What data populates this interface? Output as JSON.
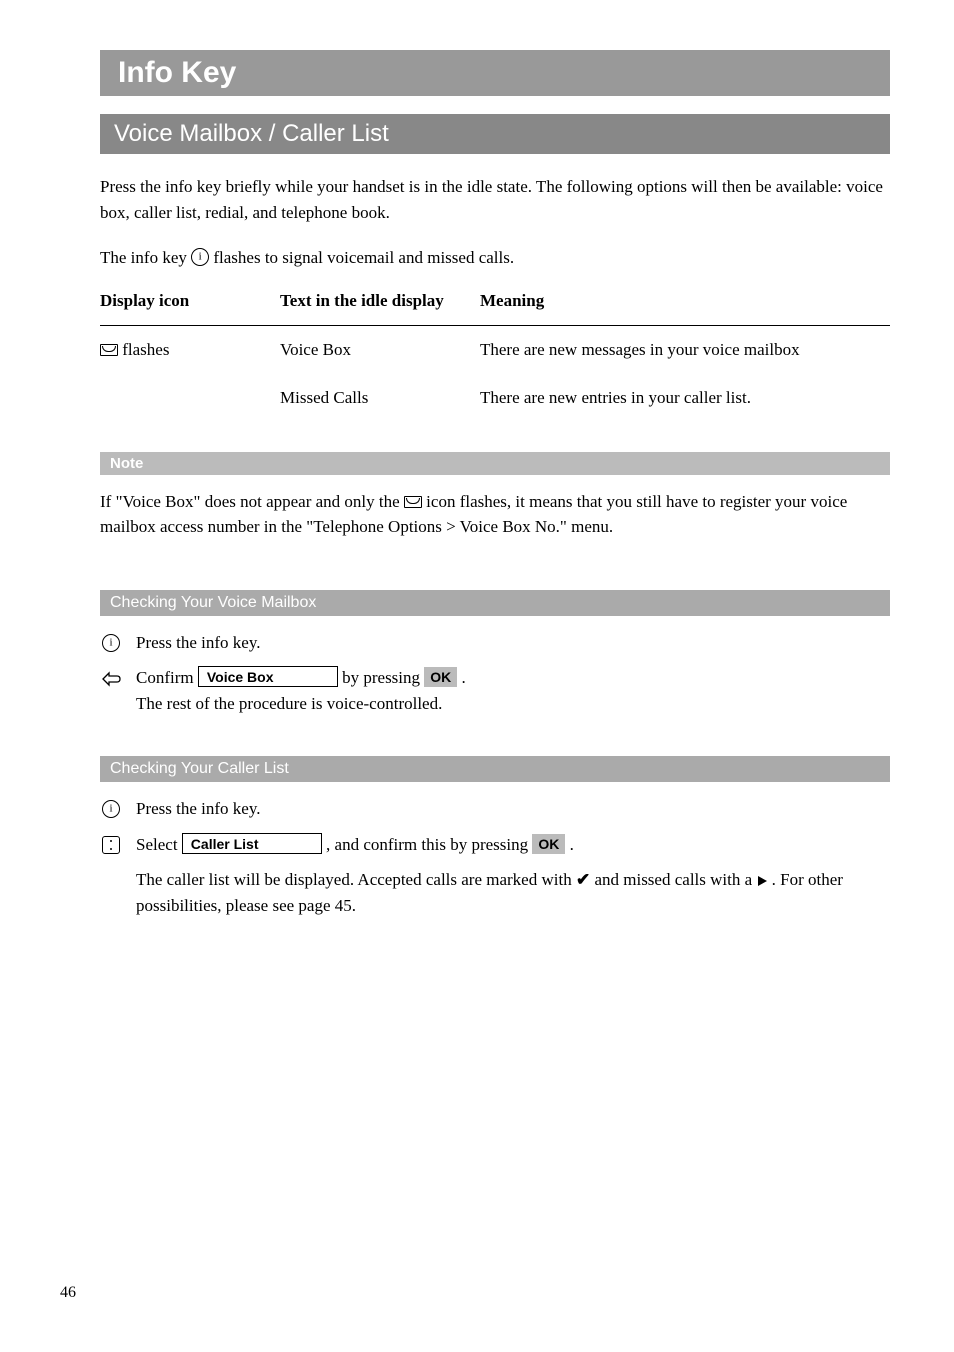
{
  "page_number": "46",
  "h1": "Info Key",
  "h2": "Voice Mailbox / Caller List",
  "intro_para": "Press the info key briefly while your handset is in the idle state. The following options will then be available: voice box, caller list, redial, and telephone book.",
  "info_line_pre": "The info key ",
  "info_line_post": " flashes to signal voicemail and missed calls.",
  "table": {
    "headers": {
      "c1": "Display icon",
      "c2": "Text in the idle display",
      "c3": "Meaning"
    },
    "rows": [
      {
        "c1_post": " flashes",
        "c2": "Voice Box",
        "c3": "There are new messages in your voice mailbox"
      },
      {
        "c1_post": "",
        "c2": "Missed Calls",
        "c3": "There are new entries in your caller list."
      }
    ]
  },
  "note_label": "Note",
  "note_pre": "If \"Voice Box\" does not appear and only the ",
  "note_post": " icon flashes, it means that you still have to register your voice mailbox access number in the \"Telephone Options > Voice Box No.\" menu.",
  "sec1": {
    "title": "Checking Your Voice Mailbox",
    "step1": "Press the info key.",
    "step2_pre": "Confirm ",
    "step2_box": "Voice Box",
    "step2_mid": " by pressing ",
    "step2_ok": "OK",
    "step2_end": " .",
    "step2_line2": "The rest of the  procedure is voice-controlled."
  },
  "sec2": {
    "title": "Checking Your Caller List",
    "step1": "Press the info key.",
    "step2_pre": "Select ",
    "step2_box": "Caller List",
    "step2_mid": " , and confirm this by pressing ",
    "step2_ok": "OK",
    "step2_end": " .",
    "result_pre": "The caller list will be displayed. Accepted calls are marked with ",
    "result_mid": " and missed calls with a ",
    "result_post": ". For other possibilities, please see  page 45."
  }
}
